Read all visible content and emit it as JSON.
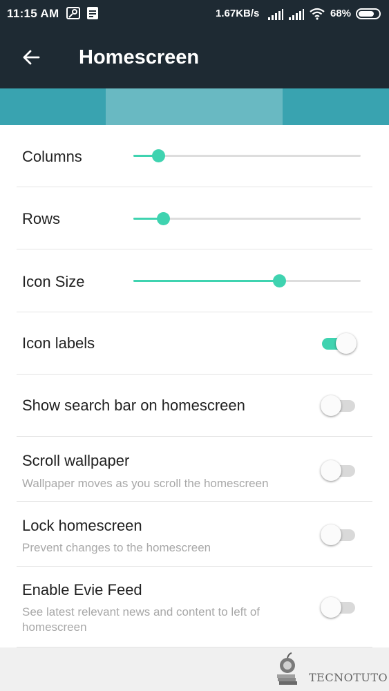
{
  "status_bar": {
    "time": "11:15 AM",
    "network_speed": "1.67KB/s",
    "battery_percent": "68%",
    "icons": [
      "location-pin-icon",
      "notes-icon",
      "signal-icon",
      "signal-icon",
      "wifi-icon",
      "battery-icon"
    ]
  },
  "app_bar": {
    "title": "Homescreen",
    "back_icon": "arrow-left-icon"
  },
  "settings": {
    "sliders": [
      {
        "label": "Columns",
        "value": 0.11
      },
      {
        "label": "Rows",
        "value": 0.13
      },
      {
        "label": "Icon Size",
        "value": 0.64
      }
    ],
    "toggles": [
      {
        "label": "Icon labels",
        "subtitle": "",
        "enabled": true
      },
      {
        "label": "Show search bar on homescreen",
        "subtitle": "",
        "enabled": false
      },
      {
        "label": "Scroll wallpaper",
        "subtitle": "Wallpaper moves as you scroll the homescreen",
        "enabled": false
      },
      {
        "label": "Lock homescreen",
        "subtitle": "Prevent changes to the homescreen",
        "enabled": false
      },
      {
        "label": "Enable Evie Feed",
        "subtitle": "See latest relevant news and content to left of homescreen",
        "enabled": false
      }
    ]
  },
  "watermark": {
    "brand": "TECNOTUTO"
  },
  "colors": {
    "app_bar": "#1e2a33",
    "tab_strip": "#39a3b0",
    "tab_selected": "#69b9c2",
    "accent": "#3fd3b0",
    "divider": "#e3e3e3"
  }
}
